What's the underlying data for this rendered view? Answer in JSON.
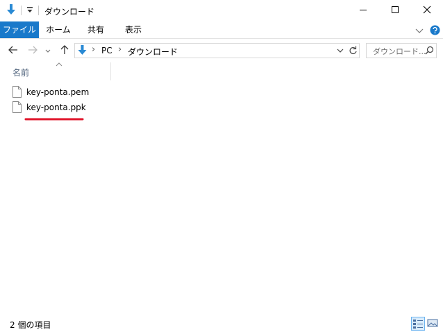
{
  "window": {
    "title": "ダウンロード"
  },
  "ribbon": {
    "tabs": [
      "ファイル",
      "ホーム",
      "共有",
      "表示"
    ]
  },
  "address": {
    "crumbs": [
      "PC",
      "ダウンロード"
    ]
  },
  "search": {
    "placeholder": "ダウンロード..."
  },
  "columns": {
    "name": "名前"
  },
  "files": [
    {
      "name": "key-ponta.pem"
    },
    {
      "name": "key-ponta.ppk"
    }
  ],
  "status": {
    "item_count": "2 個の項目"
  },
  "colors": {
    "accent": "#1979ca",
    "download_arrow": "#2a8ad4",
    "highlight_mark": "#e0142a"
  }
}
